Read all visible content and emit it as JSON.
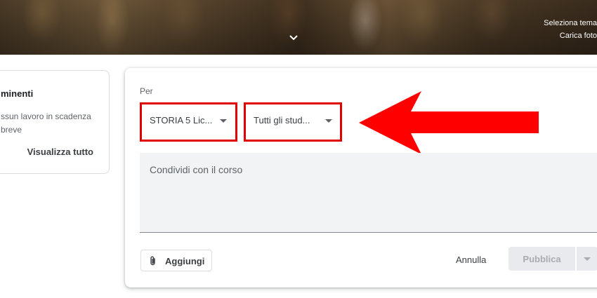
{
  "banner": {
    "select_theme": "Seleziona tema",
    "upload_photo": "Carica foto"
  },
  "upcoming": {
    "title": "minenti",
    "empty_text": "ssun lavoro in scadenza breve",
    "view_all": "Visualizza tutto"
  },
  "composer": {
    "for_label": "Per",
    "course_select": "STORIA 5 Lic...",
    "students_select": "Tutti gli stud...",
    "placeholder": "Condividi con il corso",
    "add_label": "Aggiungi",
    "cancel_label": "Annulla",
    "publish_label": "Pubblica"
  },
  "colors": {
    "highlight_red": "#e00000",
    "arrow_red": "#ff0000",
    "disabled_button": "#e8eaed"
  },
  "icons": {
    "banner_expand": "chevron-down-icon",
    "add": "paperclip-icon",
    "dropdown": "caret-down-icon"
  }
}
